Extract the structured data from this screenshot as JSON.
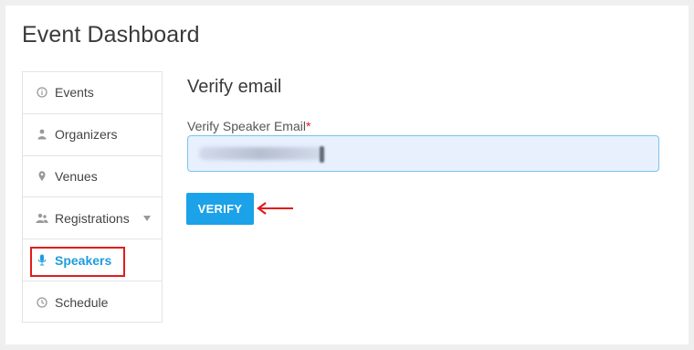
{
  "page": {
    "title": "Event Dashboard"
  },
  "sidebar": {
    "items": [
      {
        "label": "Events",
        "icon": "info-circle-icon",
        "active": false
      },
      {
        "label": "Organizers",
        "icon": "user-icon",
        "active": false
      },
      {
        "label": "Venues",
        "icon": "map-pin-icon",
        "active": false
      },
      {
        "label": "Registrations",
        "icon": "users-icon",
        "active": false,
        "has_dropdown": true
      },
      {
        "label": "Speakers",
        "icon": "microphone-icon",
        "active": true
      },
      {
        "label": "Schedule",
        "icon": "clock-icon",
        "active": false
      }
    ]
  },
  "main": {
    "title": "Verify email",
    "field_label": "Verify Speaker Email",
    "required_marker": "*",
    "email_value": "",
    "verify_label": "VERIFY"
  },
  "colors": {
    "accent": "#1ba2e8",
    "active_text": "#1e9ce0",
    "annotation_red": "#e21b1b",
    "input_bg": "#e8f0fe"
  }
}
